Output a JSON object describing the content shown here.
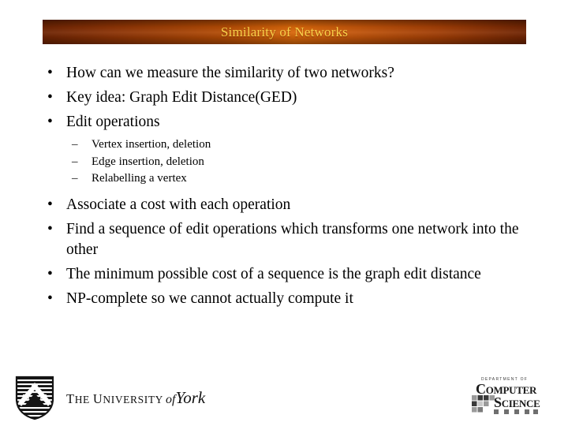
{
  "slide": {
    "title": "Similarity of Networks",
    "title_colors": {
      "text": "#fbd24a",
      "bar_dark": "#6e2403",
      "bar_bright": "#d8670a"
    },
    "background": "#ffffff",
    "bullet_marker": "•",
    "sub_bullet_marker": "–",
    "bullets": [
      {
        "text": "How can we measure the similarity of two networks?"
      },
      {
        "text": "Key idea: Graph Edit Distance(GED)"
      },
      {
        "text": "Edit operations"
      },
      {
        "text": "Associate a cost with each operation"
      },
      {
        "text": "Find a sequence of edit operations which transforms one network into the other"
      },
      {
        "text": "The minimum possible cost of a sequence is the graph edit distance"
      },
      {
        "text": "NP-complete so we cannot actually compute it"
      }
    ],
    "sub_bullets": [
      {
        "text": "Vertex insertion, deletion"
      },
      {
        "text": "Edge insertion, deletion"
      },
      {
        "text": "Relabelling a vertex"
      }
    ]
  },
  "footer": {
    "york": {
      "the": "T",
      "the_rest": "HE ",
      "university_cap": "U",
      "university_rest": "NIVERSITY",
      "of": "of",
      "york": "York",
      "crest_name": "york-shield-crest"
    },
    "computer_science": {
      "department": "DEPARTMENT OF",
      "line1": "Computer",
      "line2": "Science"
    }
  }
}
